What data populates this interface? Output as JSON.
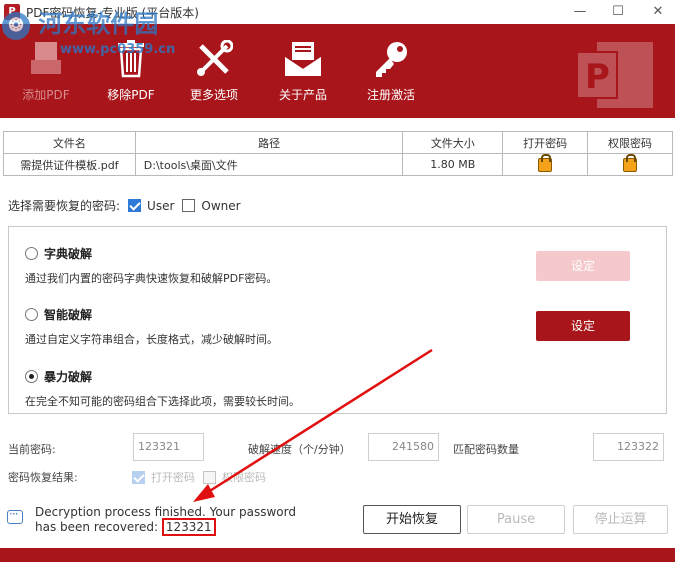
{
  "window": {
    "title": "PDF密码恢复-专业版 (平台版本)",
    "minimize": "—",
    "maximize": "☐",
    "close": "✕"
  },
  "watermark": {
    "main": "河东软件园",
    "sub": "www.pc0359.cn"
  },
  "toolbar": {
    "items": [
      {
        "label": "添加PDF",
        "icon": "add-pdf-icon",
        "disabled": true
      },
      {
        "label": "移除PDF",
        "icon": "trash-icon"
      },
      {
        "label": "更多选项",
        "icon": "tools-icon"
      },
      {
        "label": "关于产品",
        "icon": "envelope-icon"
      },
      {
        "label": "注册激活",
        "icon": "key-icon"
      }
    ]
  },
  "file_table": {
    "headers": [
      "文件名",
      "路径",
      "文件大小",
      "打开密码",
      "权限密码"
    ],
    "rows": [
      {
        "name": "需提供证件模板.pdf",
        "path": "D:\\tools\\桌面\\文件",
        "size": "1.80 MB"
      }
    ]
  },
  "password_type": {
    "label": "选择需要恢复的密码:",
    "user": {
      "label": "User",
      "checked": true
    },
    "owner": {
      "label": "Owner",
      "checked": false
    }
  },
  "methods": [
    {
      "title": "字典破解",
      "desc": "通过我们内置的密码字典快速恢复和破解PDF密码。",
      "selected": false,
      "button": "设定",
      "button_enabled": false
    },
    {
      "title": "智能破解",
      "desc": "通过自定义字符串组合，长度格式，减少破解时间。",
      "selected": false,
      "button": "设定",
      "button_enabled": true
    },
    {
      "title": "暴力破解",
      "desc": "在完全不知可能的密码组合下选择此项，需要较长时间。",
      "selected": true
    }
  ],
  "stats": {
    "current_password_label": "当前密码:",
    "current_password": "123321",
    "speed_label": "破解速度（个/分钟）",
    "speed": "241580",
    "match_count_label": "匹配密码数量",
    "match_count": "123322",
    "result_label": "密码恢复结果:",
    "result_open": "打开密码",
    "result_perm": "权限密码"
  },
  "status": {
    "message": "Decryption process finished. Your password has been recovered: ",
    "password": "123321"
  },
  "buttons": {
    "start": "开始恢复",
    "pause": "Pause",
    "stop": "停止运算"
  },
  "colors": {
    "brand": "#a8161c",
    "annotation": "#e01010"
  }
}
